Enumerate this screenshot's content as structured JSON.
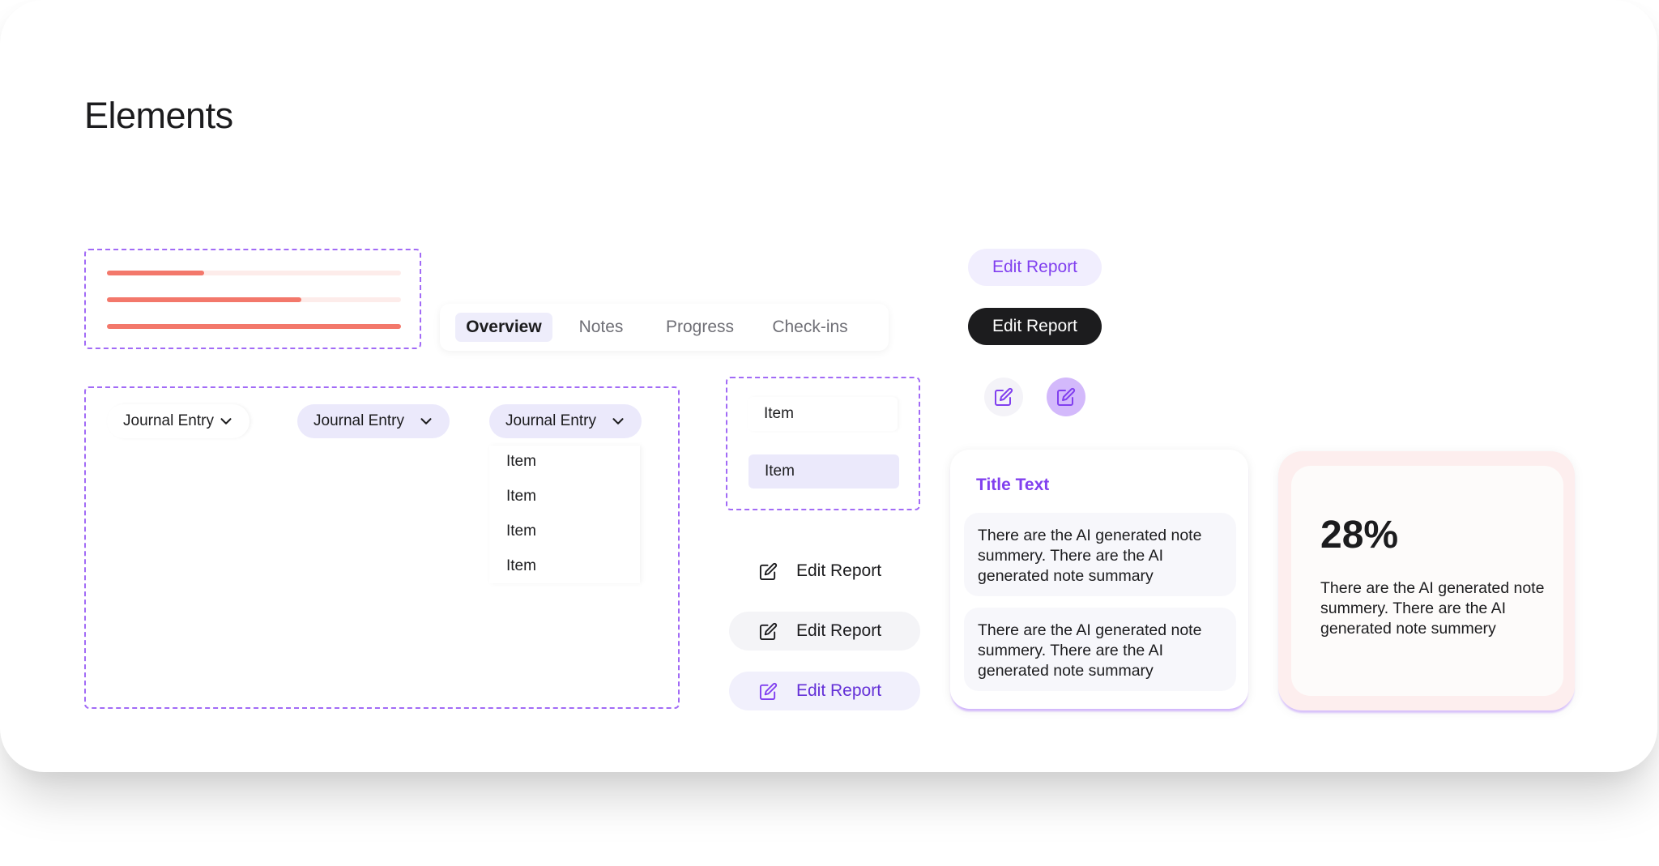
{
  "page": {
    "title": "Elements"
  },
  "progress": {
    "fill_color": "#f3786b",
    "track_color": "#fdecea",
    "bars": [
      {
        "value": 0.33
      },
      {
        "value": 0.66
      },
      {
        "value": 1.0
      }
    ]
  },
  "tabs": [
    {
      "label": "Overview",
      "active": true
    },
    {
      "label": "Notes",
      "active": false
    },
    {
      "label": "Progress",
      "active": false
    },
    {
      "label": "Check-ins",
      "active": false
    }
  ],
  "dropdowns": [
    {
      "label": "Journal Entry",
      "variant": "plain"
    },
    {
      "label": "Journal Entry",
      "variant": "filled"
    },
    {
      "label": "Journal Entry",
      "variant": "open",
      "options": [
        "Item",
        "Item",
        "Item",
        "Item"
      ]
    }
  ],
  "list": {
    "items": [
      "Item",
      "Item"
    ],
    "selected_index": 1
  },
  "buttons": {
    "edit_report_soft": "Edit Report",
    "edit_report_dark": "Edit Report",
    "edit_report_plain": "Edit Report",
    "edit_report_gray": "Edit Report",
    "edit_report_accent": "Edit Report"
  },
  "icons": {
    "edit": "edit-icon",
    "chevron": "chevron-down-icon"
  },
  "note_card": {
    "title": "Title Text",
    "notes": [
      "There are the AI generated note summery. There are the AI generated note summary",
      "There are the AI generated note summery. There are the AI generated note summary"
    ]
  },
  "stat_card": {
    "value": "28%",
    "description": "There are the AI generated note summery. There are the AI generated note summery"
  },
  "colors": {
    "accent": "#8140ef",
    "accent_soft": "#f1eefe",
    "dark": "#1c1c1e",
    "dashed_border": "#a26bf6",
    "selection": "#eeedfb"
  }
}
